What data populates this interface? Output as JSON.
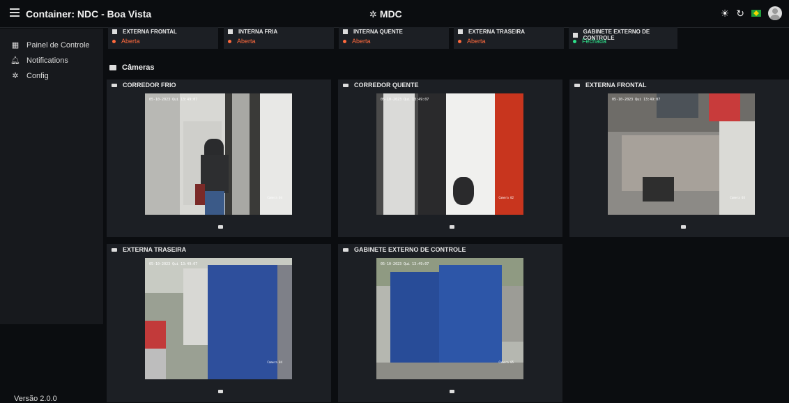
{
  "header": {
    "title": "Container: NDC - Boa Vista",
    "center_title": "MDC"
  },
  "sidebar": {
    "items": [
      {
        "label": "Painel de Controle",
        "icon": "dashboard-icon"
      },
      {
        "label": "Notifications",
        "icon": "bell-icon"
      },
      {
        "label": "Config",
        "icon": "gear-icon"
      }
    ],
    "version": "Versão 2.0.0"
  },
  "sensors": [
    {
      "name": "EXTERNA FRONTAL",
      "status": "Aberta",
      "state": "open"
    },
    {
      "name": "INTERNA FRIA",
      "status": "Aberta",
      "state": "open"
    },
    {
      "name": "INTERNA QUENTE",
      "status": "Aberta",
      "state": "open"
    },
    {
      "name": "EXTERNA TRASEIRA",
      "status": "Aberta",
      "state": "open"
    },
    {
      "name": "GABINETE EXTERNO DE CONTROLE",
      "status": "Fechada",
      "state": "closed"
    }
  ],
  "cameras_heading": "Câmeras",
  "cameras": [
    {
      "title": "CORREDOR FRIO",
      "timestamp": "05-10-2023 Qui 13:49:07",
      "label": "Camera 04"
    },
    {
      "title": "CORREDOR QUENTE",
      "timestamp": "05-10-2023 Qui 13:49:07",
      "label": "Camera 02"
    },
    {
      "title": "EXTERNA FRONTAL",
      "timestamp": "05-10-2023 Qui 13:49:07",
      "label": "Camera 03"
    },
    {
      "title": "EXTERNA TRASEIRA",
      "timestamp": "05-10-2023 Qui 13:49:07",
      "label": "Camera 04"
    },
    {
      "title": "GABINETE EXTERNO DE CONTROLE",
      "timestamp": "05-10-2023 Qui 13:49:07",
      "label": "Camera 05"
    }
  ],
  "colors": {
    "open": "#ff6a3d",
    "closed": "#2ee08a",
    "panel": "#1c1f24",
    "background": "#0b0d10"
  }
}
